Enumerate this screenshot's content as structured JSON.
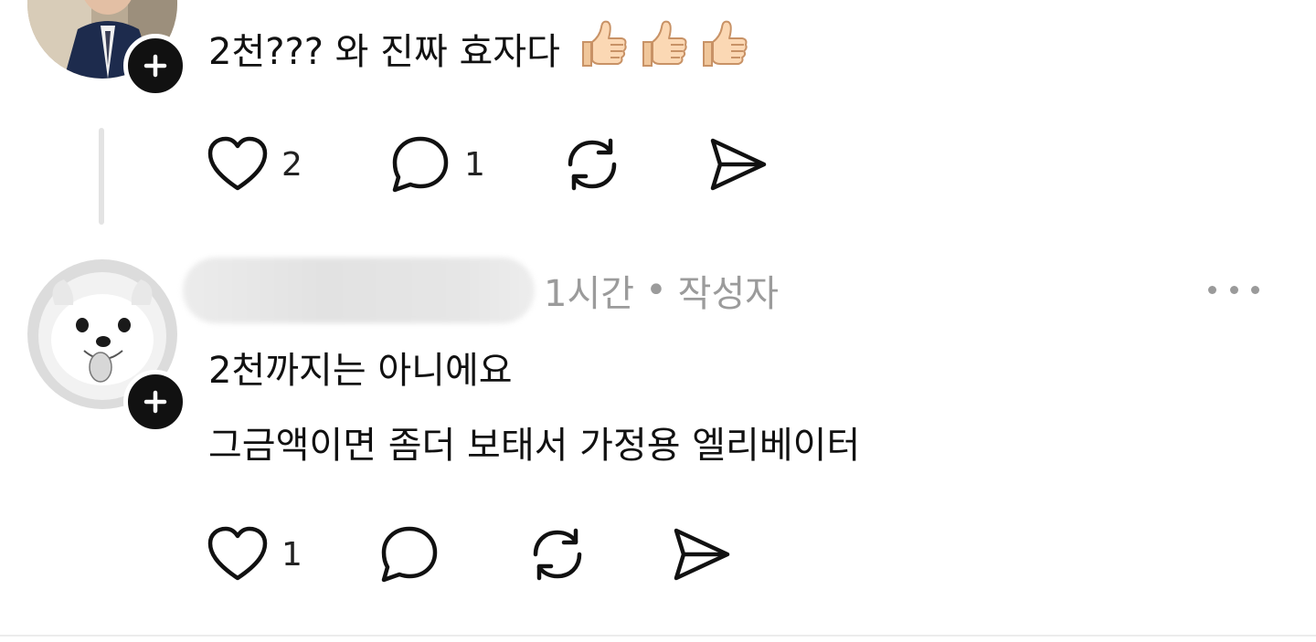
{
  "posts": [
    {
      "text": "2천??? 와 진짜 효자다",
      "emojis": [
        "thumbs-up",
        "thumbs-up",
        "thumbs-up"
      ],
      "actions": {
        "like_count": "2",
        "reply_count": "1"
      },
      "icons": {
        "follow": "plus-icon",
        "like": "heart-icon",
        "reply": "comment-icon",
        "repost": "repost-icon",
        "share": "send-icon"
      }
    },
    {
      "meta": {
        "time": "1시간",
        "separator": "•",
        "role": "작성자"
      },
      "lines": [
        "2천까지는 아니에요",
        "그금액이면 좀더 보태서 가정용 엘리베이터"
      ],
      "actions": {
        "like_count": "1"
      },
      "icons": {
        "follow": "plus-icon",
        "more": "more-horizontal-icon",
        "like": "heart-icon",
        "reply": "comment-icon",
        "repost": "repost-icon",
        "share": "send-icon"
      }
    }
  ],
  "colors": {
    "text": "#111111",
    "meta": "#9b9b9b",
    "divider": "#ececec",
    "thread_line": "#e3e3e3"
  }
}
